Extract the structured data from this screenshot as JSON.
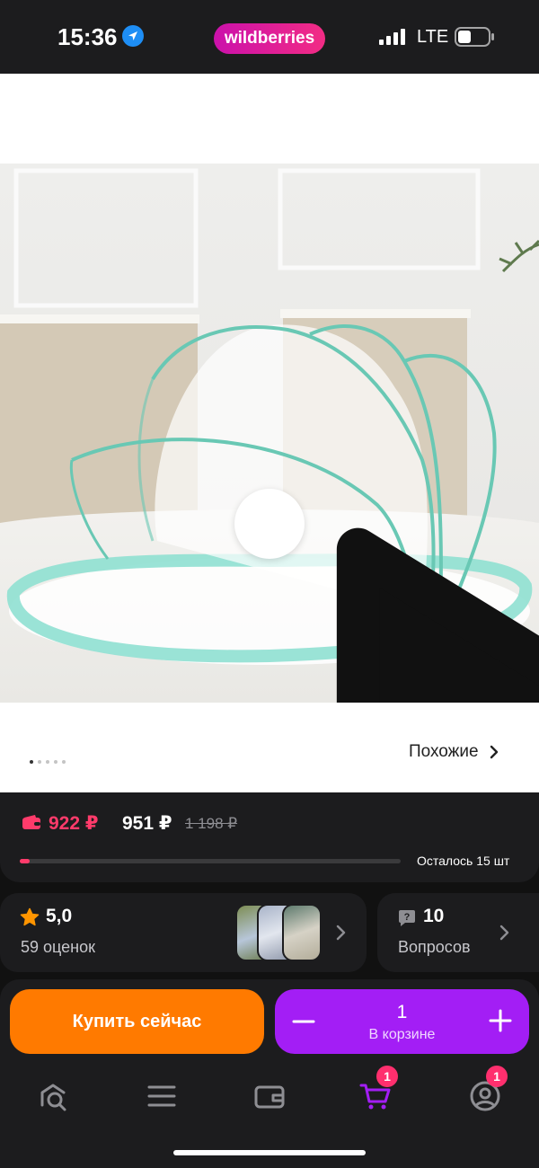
{
  "status_bar": {
    "time": "15:36",
    "brand": "wildberries",
    "network": "LTE",
    "icons": [
      "location-arrow-icon",
      "signal-bars-icon",
      "battery-icon"
    ]
  },
  "product": {
    "toolbar_icons": [
      "back-chevron-icon",
      "heart-icon",
      "share-icon"
    ],
    "image_description_icon": "play-icon",
    "gallery_dots_total": 5,
    "gallery_dots_active": 1,
    "similar_label": "Похожие"
  },
  "pricing": {
    "wallet_price": "922 ₽",
    "price": "951 ₽",
    "old_price": "1 198 ₽",
    "stock_label": "Осталось 15 шт",
    "stock_fraction": 0.025
  },
  "rating": {
    "value": "5,0",
    "count_label": "59 оценок"
  },
  "questions": {
    "count": "10",
    "label": "Вопросов"
  },
  "actions": {
    "buy_now_label": "Купить сейчас",
    "cart_quantity": "1",
    "in_cart_label": "В корзине"
  },
  "nav": {
    "items": [
      {
        "name": "home-search-icon",
        "badge": ""
      },
      {
        "name": "menu-icon",
        "badge": ""
      },
      {
        "name": "wallet-icon",
        "badge": ""
      },
      {
        "name": "cart-icon",
        "badge": "1"
      },
      {
        "name": "profile-icon",
        "badge": "1"
      }
    ]
  },
  "colors": {
    "brand_gradient_start": "#cb11ab",
    "brand_gradient_end": "#f22c84",
    "price_accent": "#ff3b6b",
    "buy_now": "#ff7a00",
    "cart_button": "#a31ef5",
    "cart_active_icon": "#a31ef5",
    "badge": "#ff2f6e"
  }
}
